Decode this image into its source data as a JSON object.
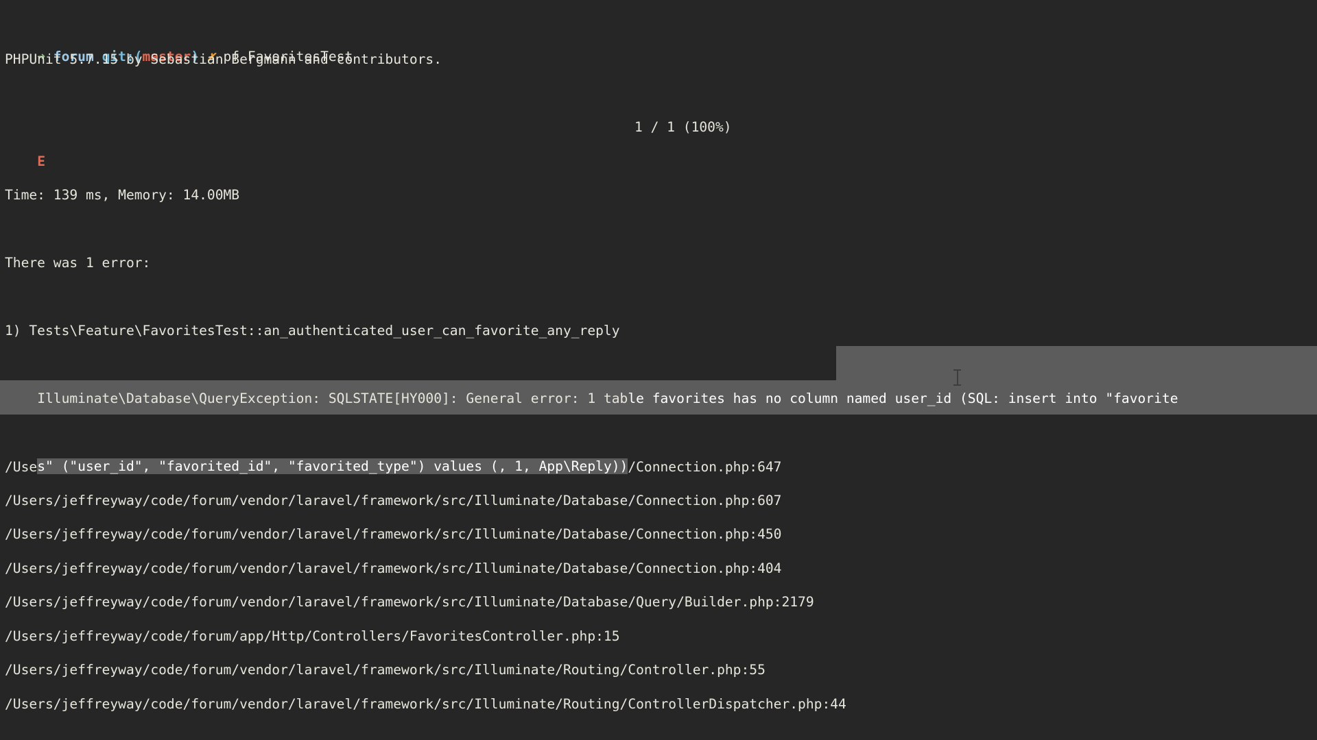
{
  "terminal": {
    "background_color": "#262626",
    "foreground_color": "#e6e6dc",
    "selection_color": "#5c5c5c",
    "prompt": {
      "arrow": "➜",
      "arrow_color": "#8ec07c",
      "directory": "forum",
      "directory_color": "#9ec9e8",
      "git_label": "git:",
      "paren_open": "(",
      "branch": "master",
      "branch_color": "#e06c55",
      "paren_close": ")",
      "status_symbol": "✗",
      "status_color": "#e3a03c",
      "command": "pf FavoritesTest"
    },
    "lines": {
      "banner": "PHPUnit 5.7.15 by Sebastian Bergmann and contributors.",
      "progress_marker": "E",
      "progress_marker_color": "#e06c55",
      "progress_count": "1 / 1 (100%)",
      "timing": "Time: 139 ms, Memory: 14.00MB",
      "error_summary": "There was 1 error:",
      "error_index": "1) Tests\\Feature\\FavoritesTest::an_authenticated_user_can_favorite_any_reply",
      "exception_part_unselected": "Illuminate\\Database\\QueryException: SQLSTATE[HY000]: General error: 1 tab",
      "exception_part_selected": "le favorites has no column named user_id (SQL: insert into \"favorite",
      "exception_wrap_selected": "s\" (\"user_id\", \"favorited_id\", \"favorited_type\") values (, 1, App\\Reply))"
    },
    "stack_trace": [
      "/Users/jeffreyway/code/forum/vendor/laravel/framework/src/Illuminate/Database/Connection.php:647",
      "/Users/jeffreyway/code/forum/vendor/laravel/framework/src/Illuminate/Database/Connection.php:607",
      "/Users/jeffreyway/code/forum/vendor/laravel/framework/src/Illuminate/Database/Connection.php:450",
      "/Users/jeffreyway/code/forum/vendor/laravel/framework/src/Illuminate/Database/Connection.php:404",
      "/Users/jeffreyway/code/forum/vendor/laravel/framework/src/Illuminate/Database/Query/Builder.php:2179",
      "/Users/jeffreyway/code/forum/app/Http/Controllers/FavoritesController.php:15",
      "/Users/jeffreyway/code/forum/vendor/laravel/framework/src/Illuminate/Routing/Controller.php:55",
      "/Users/jeffreyway/code/forum/vendor/laravel/framework/src/Illuminate/Routing/ControllerDispatcher.php:44"
    ],
    "mouse_cursor": "i-beam-cursor"
  }
}
